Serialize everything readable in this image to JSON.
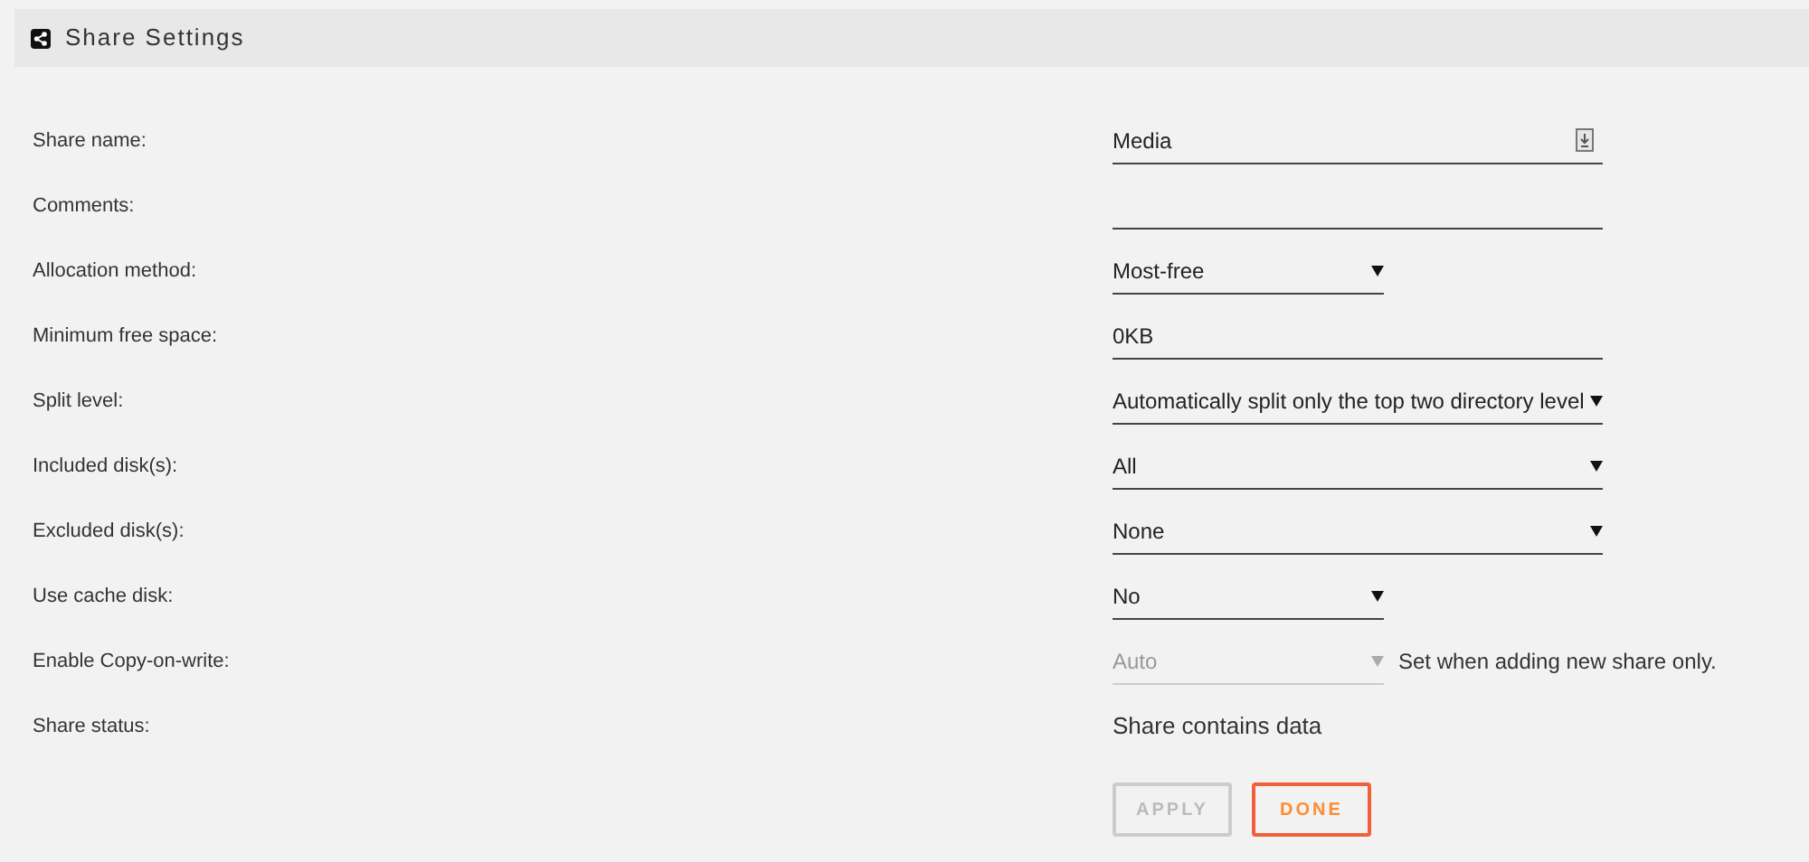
{
  "panel": {
    "title": "Share Settings"
  },
  "rows": [
    {
      "label": "Share name:",
      "kind": "text",
      "value": "Media",
      "icon": true
    },
    {
      "label": "Comments:",
      "kind": "text",
      "icon": false
    },
    {
      "label": "Allocation method:",
      "kind": "select",
      "value": "Most-free",
      "disabled": false
    },
    {
      "label": "Minimum free space:",
      "kind": "text",
      "value": "0KB",
      "icon": false
    },
    {
      "label": "Split level:",
      "kind": "wideselect",
      "value": "Automatically split only the top two directory level",
      "disabled": false
    },
    {
      "label": "Included disk(s):",
      "kind": "wideselect",
      "value": "All",
      "disabled": false
    },
    {
      "label": "Excluded disk(s):",
      "kind": "wideselect",
      "value": "None",
      "disabled": false
    },
    {
      "label": "Use cache disk:",
      "kind": "select",
      "value": "No",
      "disabled": false
    },
    {
      "label": "Enable Copy-on-write:",
      "kind": "select",
      "value": "Auto",
      "disabled": true,
      "note": "Set when adding new share only."
    },
    {
      "label": "Share status:",
      "kind": "static",
      "value": "Share contains data"
    }
  ],
  "buttons": [
    {
      "label": "APPLY",
      "disabled": true
    },
    {
      "label": "DONE",
      "disabled": false
    }
  ]
}
